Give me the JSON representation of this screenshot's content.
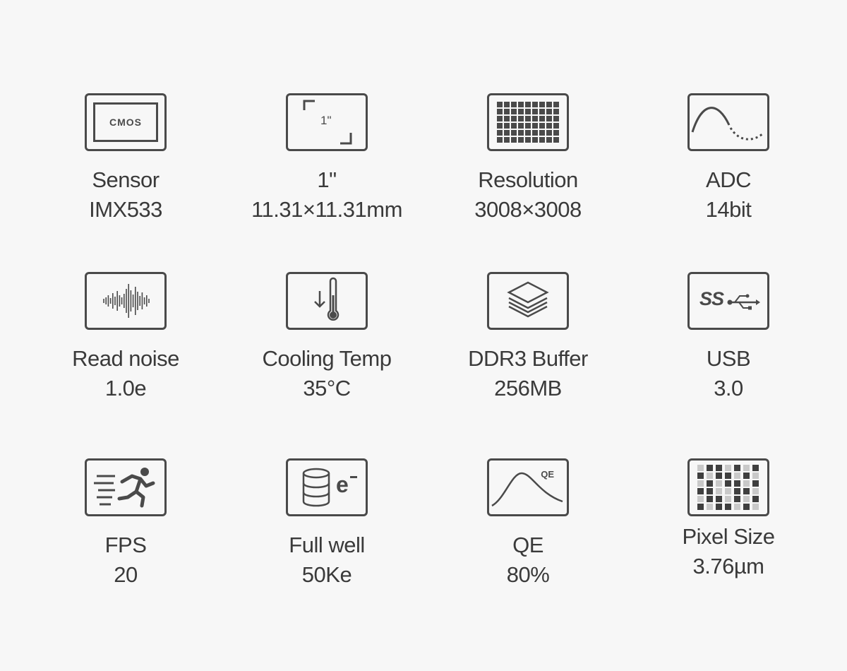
{
  "specs": [
    {
      "label": "Sensor",
      "value": "IMX533",
      "icon": "cmos-chip-icon",
      "icon_text": "CMOS"
    },
    {
      "label": "1\"",
      "value": "11.31×11.31mm",
      "icon": "sensor-size-icon",
      "icon_text": "1\""
    },
    {
      "label": "Resolution",
      "value": "3008×3008",
      "icon": "pixel-grid-icon"
    },
    {
      "label": "ADC",
      "value": "14bit",
      "icon": "sine-wave-icon"
    },
    {
      "label": "Read noise",
      "value": "1.0e",
      "icon": "sound-wave-icon"
    },
    {
      "label": "Cooling Temp",
      "value": "35°C",
      "icon": "thermometer-icon"
    },
    {
      "label": "DDR3 Buffer",
      "value": "256MB",
      "icon": "layers-icon"
    },
    {
      "label": "USB",
      "value": "3.0",
      "icon": "usb-ss-icon",
      "icon_text": "SS"
    },
    {
      "label": "FPS",
      "value": "20",
      "icon": "running-man-icon"
    },
    {
      "label": "Full well",
      "value": "50Ke",
      "icon": "database-electron-icon",
      "icon_text": "e"
    },
    {
      "label": "QE",
      "value": "80%",
      "icon": "qe-curve-icon",
      "icon_text": "QE"
    },
    {
      "label": "Pixel Size",
      "value": "3.76µm",
      "icon": "pixel-pattern-icon"
    }
  ],
  "colors": {
    "background": "#f7f7f7",
    "icon_stroke": "#4a4a4a",
    "text": "#3a3a3a"
  }
}
